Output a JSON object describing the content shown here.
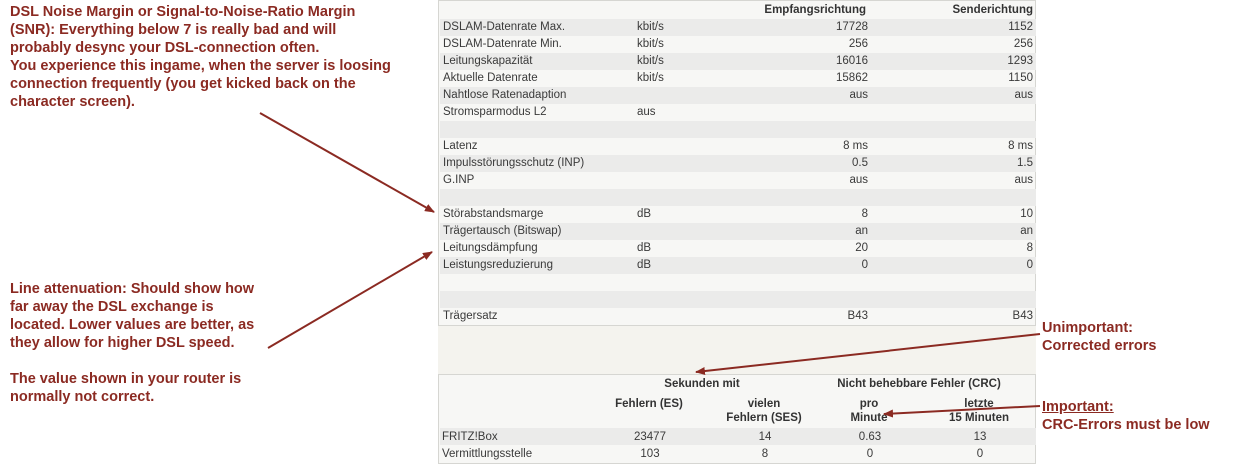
{
  "annotations": {
    "snr": [
      "DSL Noise Margin or Signal-to-Noise-Ratio Margin",
      "(SNR): Everything below 7 is really bad and will",
      "probably desync your DSL-connection often.",
      "You experience this ingame, when the server is loosing",
      "connection frequently (you get kicked back on the",
      "character screen)."
    ],
    "attenuation": [
      "Line attenuation: Should show how",
      "far away the DSL exchange is",
      "located. Lower values are better, as",
      "they allow for higher DSL speed.",
      "",
      "The value shown in your router is",
      "normally not correct."
    ],
    "unimportant": [
      "Unimportant:",
      "Corrected errors"
    ],
    "important": [
      "Important:",
      "CRC-Errors must be low"
    ]
  },
  "colors": {
    "annotation": "#8b2a22",
    "alt_row": "#ebebea",
    "panel": "#f7f7f5"
  },
  "line_table": {
    "headers": {
      "down": "Empfangsrichtung",
      "up": "Senderichtung"
    },
    "rows": [
      {
        "label": "DSLAM-Datenrate Max.",
        "unit": "kbit/s",
        "down": "17728",
        "up": "1152"
      },
      {
        "label": "DSLAM-Datenrate Min.",
        "unit": "kbit/s",
        "down": "256",
        "up": "256"
      },
      {
        "label": "Leitungskapazität",
        "unit": "kbit/s",
        "down": "16016",
        "up": "1293"
      },
      {
        "label": "Aktuelle Datenrate",
        "unit": "kbit/s",
        "down": "15862",
        "up": "1150"
      },
      {
        "label": "Nahtlose Ratenadaption",
        "unit": "",
        "down": "aus",
        "up": "aus"
      },
      {
        "label": "Stromsparmodus L2",
        "unit": "aus",
        "down": "",
        "up": ""
      },
      {
        "label": "",
        "unit": "",
        "down": "",
        "up": ""
      },
      {
        "label": "Latenz",
        "unit": "",
        "down": "8 ms",
        "up": "8 ms"
      },
      {
        "label": "Impulsstörungsschutz (INP)",
        "unit": "",
        "down": "0.5",
        "up": "1.5"
      },
      {
        "label": "G.INP",
        "unit": "",
        "down": "aus",
        "up": "aus"
      },
      {
        "label": "",
        "unit": "",
        "down": "",
        "up": ""
      },
      {
        "label": "Störabstandsmarge",
        "unit": "dB",
        "down": "8",
        "up": "10"
      },
      {
        "label": "Trägertausch (Bitswap)",
        "unit": "",
        "down": "an",
        "up": "an"
      },
      {
        "label": "Leitungsdämpfung",
        "unit": "dB",
        "down": "20",
        "up": "8"
      },
      {
        "label": "Leistungsreduzierung",
        "unit": "dB",
        "down": "0",
        "up": "0"
      },
      {
        "label": "",
        "unit": "",
        "down": "",
        "up": ""
      },
      {
        "label": "",
        "unit": "",
        "down": "",
        "up": ""
      },
      {
        "label": "Trägersatz",
        "unit": "",
        "down": "B43",
        "up": "B43"
      }
    ]
  },
  "error_table": {
    "group1": "Sekunden mit",
    "group2": "Nicht behebbare Fehler (CRC)",
    "col_es": "Fehlern (ES)",
    "col_ses_1": "vielen",
    "col_ses_2": "Fehlern (SES)",
    "col_pro_1": "pro",
    "col_pro_2": "Minute",
    "col_last_1": "letzte",
    "col_last_2": "15 Minuten",
    "rows": [
      {
        "label": "FRITZ!Box",
        "es": "23477",
        "ses": "14",
        "pro": "0.63",
        "last": "13"
      },
      {
        "label": "Vermittlungsstelle",
        "es": "103",
        "ses": "8",
        "pro": "0",
        "last": "0"
      }
    ]
  }
}
